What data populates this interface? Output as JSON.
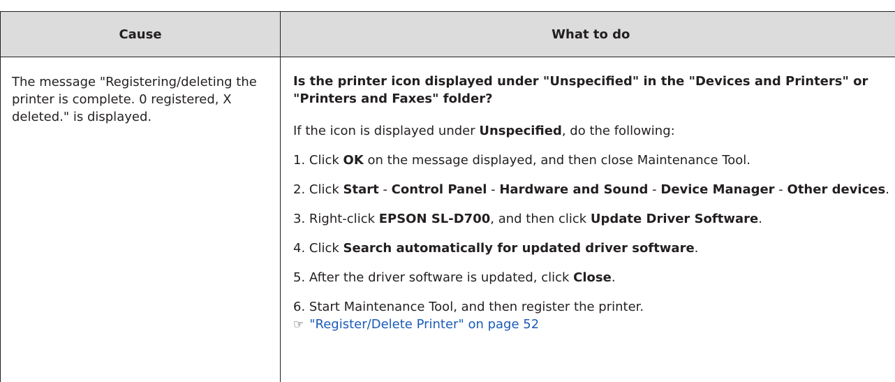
{
  "table": {
    "header": {
      "cause": "Cause",
      "what_to_do": "What to do"
    },
    "row": {
      "cause": "The message \"Registering/deleting the printer is complete. 0 registered, X deleted.\" is displayed.",
      "question": "Is the printer icon displayed under \"Unspecified\" in the \"Devices and Printers\" or \"Printers and Faxes\" folder?",
      "intro": {
        "pre": "If the icon is displayed under ",
        "bold": "Unspecified",
        "post": ", do the following:"
      },
      "step1": {
        "pre": "1. Click ",
        "bold1": "OK",
        "post": " on the message displayed, and then close Maintenance Tool."
      },
      "step2": {
        "pre": "2. Click ",
        "start": "Start",
        "sep": " - ",
        "control_panel": "Control Panel",
        "hardware": "Hardware and Sound",
        "device_manager": "Device Manager",
        "other_devices": "Other devices",
        "post": "."
      },
      "step3": {
        "pre": "3. Right-click ",
        "model": "EPSON SL-D700",
        "mid": ", and then click ",
        "update": "Update Driver Software",
        "post": "."
      },
      "step4": {
        "pre": "4. Click ",
        "bold": "Search automatically for updated driver software",
        "post": "."
      },
      "step5": {
        "pre": "5. After the driver software is updated, click ",
        "bold": "Close",
        "post": "."
      },
      "step6": {
        "text": "6. Start Maintenance Tool, and then register the printer.",
        "ref_icon": "☞",
        "link": "\"Register/Delete Printer\" on page 52"
      }
    }
  }
}
